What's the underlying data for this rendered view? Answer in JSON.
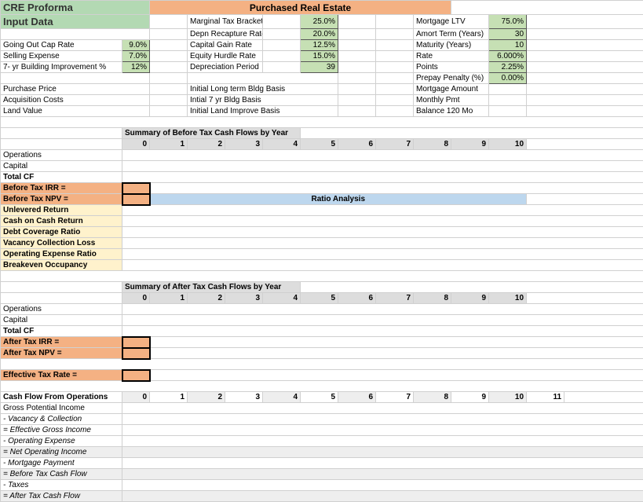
{
  "title_left": "CRE Proforma",
  "title_right": "Purchased Real Estate",
  "input_data_label": "Input Data",
  "inputs_left": {
    "going_out_cap": "Going Out Cap Rate",
    "going_out_cap_v": "9.0%",
    "selling_expense": "Selling Expense",
    "selling_expense_v": "7.0%",
    "bldg_improve": "7- yr Building Improvement %",
    "bldg_improve_v": "12%",
    "purchase_price": "Purchase Price",
    "acq_costs": "Acquisition Costs",
    "land_value": "Land Value"
  },
  "inputs_mid": {
    "marginal_tax": "Marginal Tax Bracket",
    "marginal_tax_v": "25.0%",
    "depn_recap": "Depn Recapture Rate",
    "depn_recap_v": "20.0%",
    "cap_gain": "Capital Gain Rate",
    "cap_gain_v": "12.5%",
    "eq_hurdle": "Equity Hurdle Rate",
    "eq_hurdle_v": "15.0%",
    "depr_period": "Depreciation Period",
    "depr_period_v": "39",
    "init_lt_bldg": "Initial Long term Bldg Basis",
    "init_7yr_bldg": "Intial 7 yr Bldg Basis",
    "init_land": "Initial Land Improve Basis"
  },
  "inputs_right": {
    "ltv": "Mortgage LTV",
    "ltv_v": "75.0%",
    "amort": "Amort Term (Years)",
    "amort_v": "30",
    "maturity": "Maturity (Years)",
    "maturity_v": "10",
    "rate": "Rate",
    "rate_v": "6.000%",
    "points": "Points",
    "points_v": "2.25%",
    "prepay": "Prepay Penalty (%)",
    "prepay_v": "0.00%",
    "mort_amt": "Mortgage Amount",
    "monthly_pmt": "Monthly Pmt",
    "balance": "Balance 120 Mo"
  },
  "summary_before": "Summary of Before Tax Cash Flows by Year",
  "summary_after": "Summary of After Tax Cash Flows by Year",
  "years": [
    "0",
    "1",
    "2",
    "3",
    "4",
    "5",
    "6",
    "7",
    "8",
    "9",
    "10"
  ],
  "years11": [
    "0",
    "1",
    "2",
    "3",
    "4",
    "5",
    "6",
    "7",
    "8",
    "9",
    "10",
    "11"
  ],
  "rows": {
    "operations": "Operations",
    "capital": "Capital",
    "total_cf": "Total CF",
    "btx_irr": "Before Tax IRR =",
    "btx_npv": "Before Tax NPV =",
    "atx_irr": "After Tax IRR =",
    "atx_npv": "After Tax NPV =",
    "eff_tax": "Effective Tax Rate ="
  },
  "ratio_hdr": "Ratio Analysis",
  "ratios": {
    "unlev": "Unlevered Return",
    "coc": "Cash on Cash Return",
    "dcr": "Debt Coverage Ratio",
    "vcl": "Vacancy Collection Loss",
    "oer": "Operating Expense Ratio",
    "beo": "Breakeven Occupancy"
  },
  "cfo_hdr": "Cash Flow From Operations",
  "cfo": {
    "gpi": "Gross Potential Income",
    "vac": " - Vacancy & Collection",
    "egi": " = Effective Gross Income",
    "oe": " - Operating Expense",
    "noi": " = Net Operating Income",
    "mort": " - Mortgage Payment",
    "btcf": " = Before Tax Cash Flow",
    "taxes": " - Taxes",
    "atcf": " = After Tax Cash Flow"
  }
}
